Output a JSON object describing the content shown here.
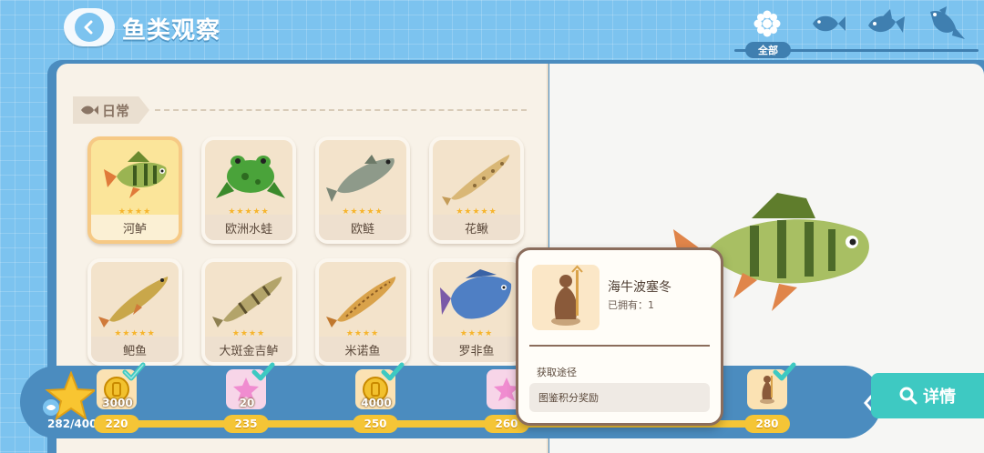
{
  "header": {
    "title": "鱼类观察",
    "filters": [
      {
        "icon": "all-flower-icon",
        "label": "全部",
        "active": true
      },
      {
        "icon": "small-fish-icon"
      },
      {
        "icon": "medium-fish-icon"
      },
      {
        "icon": "large-fish-icon"
      }
    ]
  },
  "section": {
    "label": "日常"
  },
  "fish": [
    {
      "name": "河鲈",
      "stars": "★★★★",
      "selected": true
    },
    {
      "name": "欧洲水蛙",
      "stars": "★★★★★"
    },
    {
      "name": "欧鲢",
      "stars": "★★★★★"
    },
    {
      "name": "花鳅",
      "stars": "★★★★★"
    },
    {
      "name": "鲃鱼",
      "stars": "★★★★★"
    },
    {
      "name": "大斑金吉鲈",
      "stars": "★★★★"
    },
    {
      "name": "米诺鱼",
      "stars": "★★★★"
    },
    {
      "name": "罗非鱼",
      "stars": "★★★★"
    }
  ],
  "popup": {
    "name": "海牛波塞冬",
    "owned": "已拥有：1",
    "source_title": "获取途径",
    "source_value": "图鉴积分奖励"
  },
  "rewards": {
    "score": "282/400",
    "items": [
      {
        "count": "3000",
        "milestone": "220",
        "icon": "coin-icon",
        "claimed": true
      },
      {
        "count": "20",
        "milestone": "235",
        "icon": "pink-star-icon",
        "claimed": true
      },
      {
        "count": "4000",
        "milestone": "250",
        "icon": "coin-icon",
        "claimed": true
      },
      {
        "count": "",
        "milestone": "260",
        "icon": "pink-star-icon",
        "claimed": true
      },
      {
        "count": "",
        "milestone": "280",
        "icon": "statue-icon",
        "claimed": true
      }
    ]
  },
  "detail_button": "详情",
  "colors": {
    "background": "#7cc3ef",
    "book": "#4b8cbf",
    "page": "#f8f2e8",
    "accent_teal": "#3ec9c2",
    "progress": "#f5c536"
  }
}
